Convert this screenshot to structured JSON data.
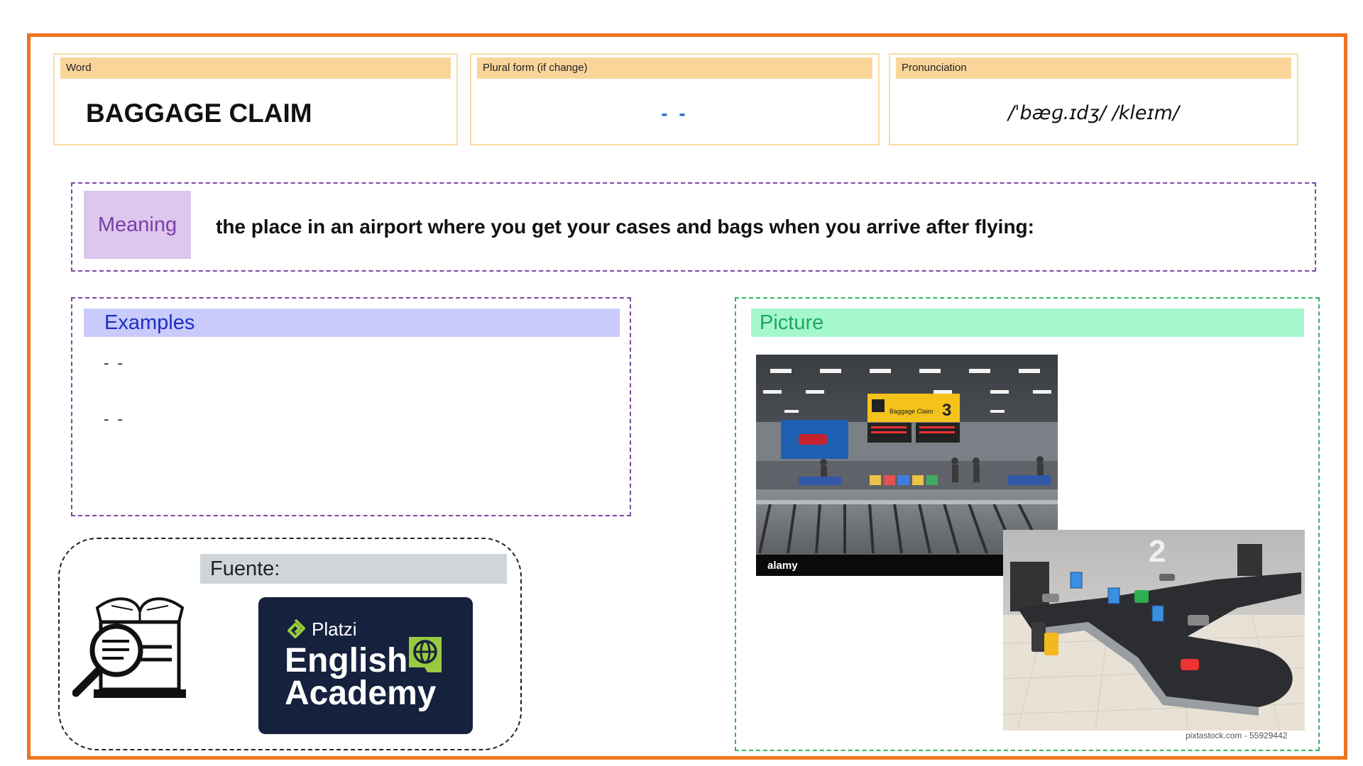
{
  "word_card": {
    "header": "Word",
    "value": "BAGGAGE CLAIM"
  },
  "plural_card": {
    "header": "Plural form (if change)",
    "value": "- -"
  },
  "pronunciation_card": {
    "header": "Pronunciation",
    "value": "/ˈbæɡ.ɪdʒ/ /kleɪm/"
  },
  "meaning": {
    "label": "Meaning",
    "text": "the place in an airport where you get your cases and bags when you arrive after flying:"
  },
  "examples": {
    "header": "Examples",
    "items": [
      "- -",
      "- -"
    ]
  },
  "picture": {
    "header": "Picture",
    "photo1_watermark": "alamy",
    "photo1_sign_title": "Baggage Claim",
    "photo1_sign_number": "3",
    "photo2_gate_number": "2",
    "photo2_credit": "pixtastock.com - 55929442"
  },
  "source": {
    "header": "Fuente:",
    "logo_brand": "Platzi",
    "logo_line1": "English",
    "logo_line2": "Academy"
  },
  "colors": {
    "frame": "#ee7420",
    "card_header": "#fad59a",
    "meaning_label_bg": "#ddc7ec",
    "examples_header_bg": "#c9cbfb",
    "picture_header_bg": "#a6f7cd",
    "platzi_bg": "#15213d",
    "platzi_green": "#98ca3f"
  }
}
